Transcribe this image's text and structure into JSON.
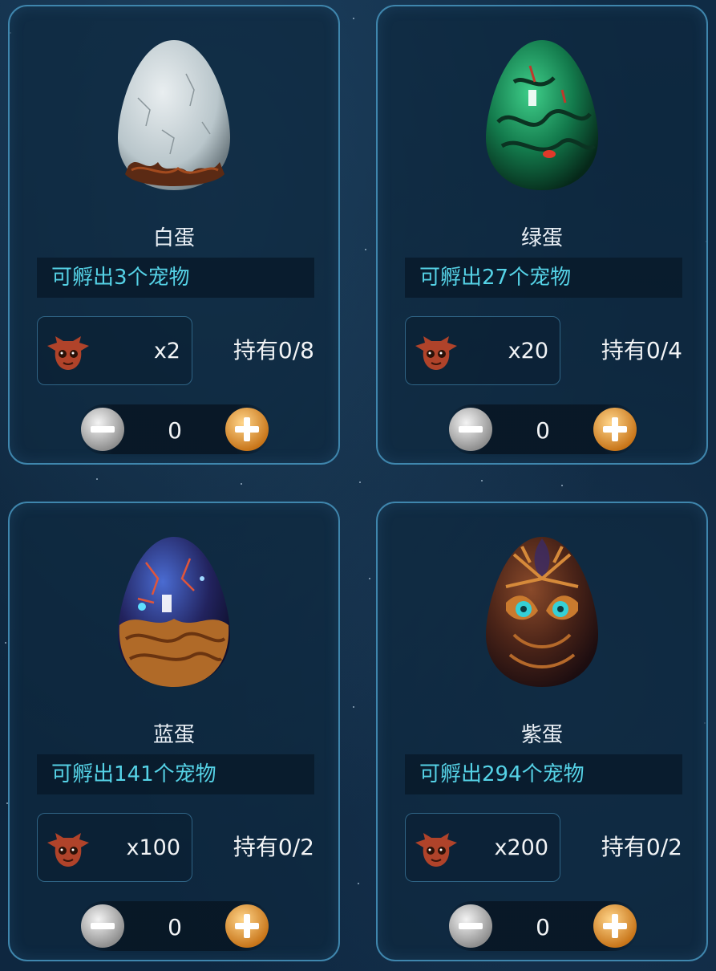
{
  "colors": {
    "accent_cyan": "#55d2e6",
    "card_border": "#3f86ad",
    "plus_orange": "#e19a3a",
    "minus_gray": "#bfbfbf"
  },
  "cards": [
    {
      "name": "白蛋",
      "hatch_text": "可孵出3个宠物",
      "cost_icon": "demon-face-icon",
      "cost_qty": "x2",
      "owned": "持有0/8",
      "count": "0",
      "egg_style": "white"
    },
    {
      "name": "绿蛋",
      "hatch_text": "可孵出27个宠物",
      "cost_icon": "demon-face-icon",
      "cost_qty": "x20",
      "owned": "持有0/4",
      "count": "0",
      "egg_style": "green"
    },
    {
      "name": "蓝蛋",
      "hatch_text": "可孵出141个宠物",
      "cost_icon": "demon-face-icon",
      "cost_qty": "x100",
      "owned": "持有0/2",
      "count": "0",
      "egg_style": "blue"
    },
    {
      "name": "紫蛋",
      "hatch_text": "可孵出294个宠物",
      "cost_icon": "demon-face-icon",
      "cost_qty": "x200",
      "owned": "持有0/2",
      "count": "0",
      "egg_style": "purple"
    }
  ]
}
